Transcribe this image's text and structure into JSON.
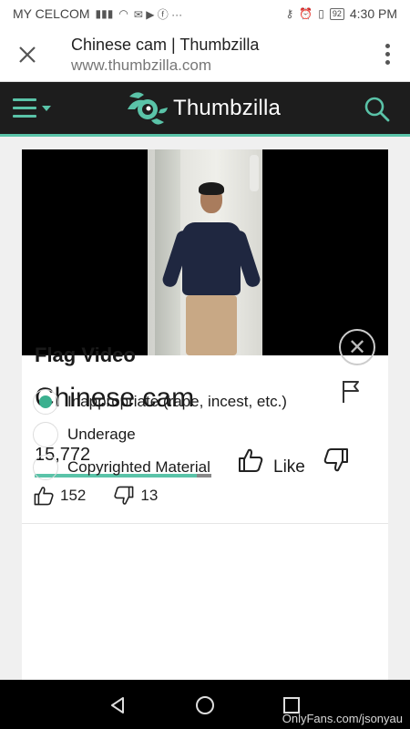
{
  "status_bar": {
    "carrier": "MY CELCOM",
    "battery": "92",
    "time": "4:30 PM"
  },
  "tab": {
    "title": "Chinese cam | Thumbzilla",
    "url": "www.thumbzilla.com"
  },
  "site": {
    "logo_text": "Thumbzilla",
    "accent_color": "#5ac3a8"
  },
  "video": {
    "title": "Chinese cam",
    "views": "15,772",
    "rating_fraction": 0.92,
    "like_label": "Like",
    "likes": "152",
    "dislikes": "13"
  },
  "flag_panel": {
    "heading": "Flag Video",
    "options": [
      {
        "label": "Inappropriate (rape, incest, etc.)",
        "checked": true
      },
      {
        "label": "Underage",
        "checked": false
      },
      {
        "label": "Copyrighted Material",
        "checked": false
      }
    ]
  },
  "watermark": "OnlyFans.com/jsonyau"
}
